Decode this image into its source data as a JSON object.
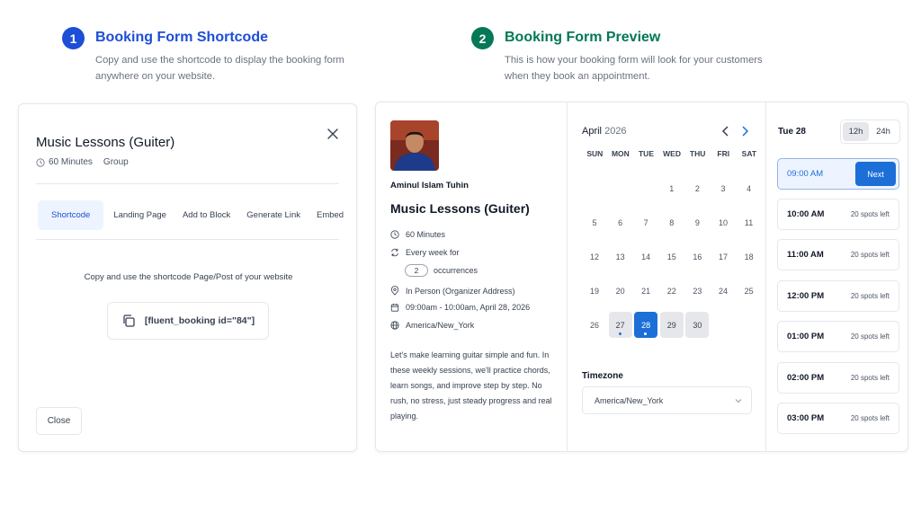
{
  "steps": [
    {
      "number": "1",
      "title": "Booking Form Shortcode",
      "description": "Copy and use the shortcode to display the booking form anywhere on your website."
    },
    {
      "number": "2",
      "title": "Booking Form Preview",
      "description": "This is how your booking form will look for your customers when they book an appointment."
    }
  ],
  "modal": {
    "title": "Music Lessons (Guiter)",
    "duration": "60 Minutes",
    "type": "Group",
    "tabs": [
      "Shortcode",
      "Landing Page",
      "Add to Block",
      "Generate Link",
      "Embed"
    ],
    "active_tab": "Shortcode",
    "instruction": "Copy and use the shortcode Page/Post of your website",
    "shortcode": "[fluent_booking id=\"84\"]",
    "close_label": "Close"
  },
  "preview": {
    "host_name": "Aminul Islam Tuhin",
    "event_title": "Music Lessons (Guiter)",
    "duration": "60 Minutes",
    "recurrence": "Every week for",
    "occurrences_value": "2",
    "occurrences_label": "occurrences",
    "location": "In Person (Organizer Address)",
    "datetime": "09:00am - 10:00am, April 28, 2026",
    "timezone_text": "America/New_York",
    "description": "Let's make learning guitar simple and fun. In these weekly sessions, we'll practice chords, learn songs, and improve step by step. No rush, no stress, just steady progress and real playing.",
    "calendar": {
      "month": "April",
      "year": "2026",
      "weekdays": [
        "SUN",
        "MON",
        "TUE",
        "WED",
        "THU",
        "FRI",
        "SAT"
      ],
      "first_weekday_index": 3,
      "days_in_month": 30,
      "available_days": [
        27,
        28,
        29,
        30
      ],
      "dotted_days": [
        27,
        28
      ],
      "selected_day": 28
    },
    "timezone_label": "Timezone",
    "timezone_value": "America/New_York",
    "slots_day": "Tue 28",
    "format_12": "12h",
    "format_24": "24h",
    "selected_slot": "09:00 AM",
    "next_label": "Next",
    "slots": [
      {
        "time": "10:00 AM",
        "spots": "20 spots left"
      },
      {
        "time": "11:00 AM",
        "spots": "20 spots left"
      },
      {
        "time": "12:00 PM",
        "spots": "20 spots left"
      },
      {
        "time": "01:00 PM",
        "spots": "20 spots left"
      },
      {
        "time": "02:00 PM",
        "spots": "20 spots left"
      },
      {
        "time": "03:00 PM",
        "spots": "20 spots left"
      }
    ]
  },
  "colors": {
    "primary_blue": "#1d4ed8",
    "primary_green": "#047857",
    "selected_day": "#1d6fd8"
  }
}
